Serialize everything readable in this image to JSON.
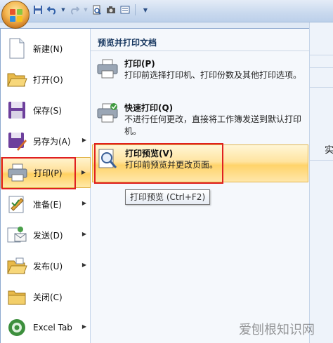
{
  "toolbar": {
    "icons": [
      "save-icon",
      "undo-icon",
      "redo-icon",
      "print-preview-icon",
      "camera-icon",
      "form-icon",
      "customize-arrow-icon"
    ]
  },
  "background": {
    "char": "实"
  },
  "left_menu": {
    "items": [
      {
        "label": "新建(N)",
        "icon": "new-document-icon",
        "has_arrow": false
      },
      {
        "label": "打开(O)",
        "icon": "open-folder-icon",
        "has_arrow": false
      },
      {
        "label": "保存(S)",
        "icon": "save-disk-icon",
        "has_arrow": false
      },
      {
        "label": "另存为(A)",
        "icon": "save-as-icon",
        "has_arrow": true
      },
      {
        "label": "打印(P)",
        "icon": "printer-icon",
        "has_arrow": true,
        "active": true
      },
      {
        "label": "准备(E)",
        "icon": "prepare-icon",
        "has_arrow": true
      },
      {
        "label": "发送(D)",
        "icon": "send-icon",
        "has_arrow": true
      },
      {
        "label": "发布(U)",
        "icon": "publish-icon",
        "has_arrow": true
      },
      {
        "label": "关闭(C)",
        "icon": "close-folder-icon",
        "has_arrow": false
      },
      {
        "label": "Excel Tab",
        "icon": "excel-tab-icon",
        "has_arrow": true
      }
    ]
  },
  "right_menu": {
    "header": "预览并打印文档",
    "items": [
      {
        "title": "打印(P)",
        "desc": "打印前选择打印机、打印份数及其他打印选项。",
        "icon": "printer-icon"
      },
      {
        "title": "快速打印(Q)",
        "desc": "不进行任何更改，直接将工作簿发送到默认打印机。",
        "icon": "quick-print-icon"
      },
      {
        "title": "打印预览(V)",
        "desc": "打印前预览并更改页面。",
        "icon": "print-preview-icon",
        "active": true
      }
    ]
  },
  "tooltip": "打印预览 (Ctrl+F2)",
  "watermark": "爱刨根知识网",
  "colors": {
    "highlight": "#ffd36a",
    "annotation_red": "#e02020",
    "header_text": "#16365f"
  }
}
